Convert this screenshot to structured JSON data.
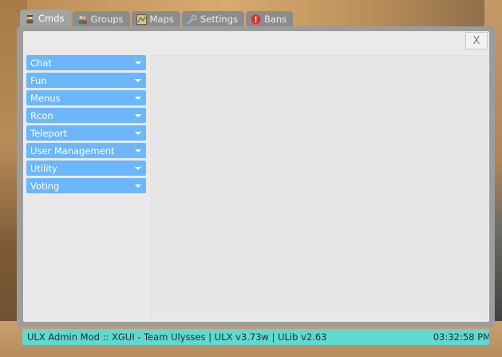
{
  "tabs": [
    {
      "label": "Cmds",
      "icon": "person-icon",
      "active": true
    },
    {
      "label": "Groups",
      "icon": "users-icon",
      "active": false
    },
    {
      "label": "Maps",
      "icon": "map-icon",
      "active": false
    },
    {
      "label": "Settings",
      "icon": "wrench-icon",
      "active": false
    },
    {
      "label": "Bans",
      "icon": "ban-icon",
      "active": false
    }
  ],
  "close_label": "X",
  "categories": [
    {
      "label": "Chat"
    },
    {
      "label": "Fun"
    },
    {
      "label": "Menus"
    },
    {
      "label": "Rcon"
    },
    {
      "label": "Teleport"
    },
    {
      "label": "User Management"
    },
    {
      "label": "Utility"
    },
    {
      "label": "Voting"
    }
  ],
  "status_bar": {
    "info": "ULX Admin Mod :: XGUI - Team Ulysses |  ULX v3.73w  |  ULib v2.63",
    "time": "03:32:58 PM"
  },
  "colors": {
    "accent": "#6cb6fa",
    "status_bg": "#5fd9d2",
    "ban_icon": "#d9342b"
  }
}
